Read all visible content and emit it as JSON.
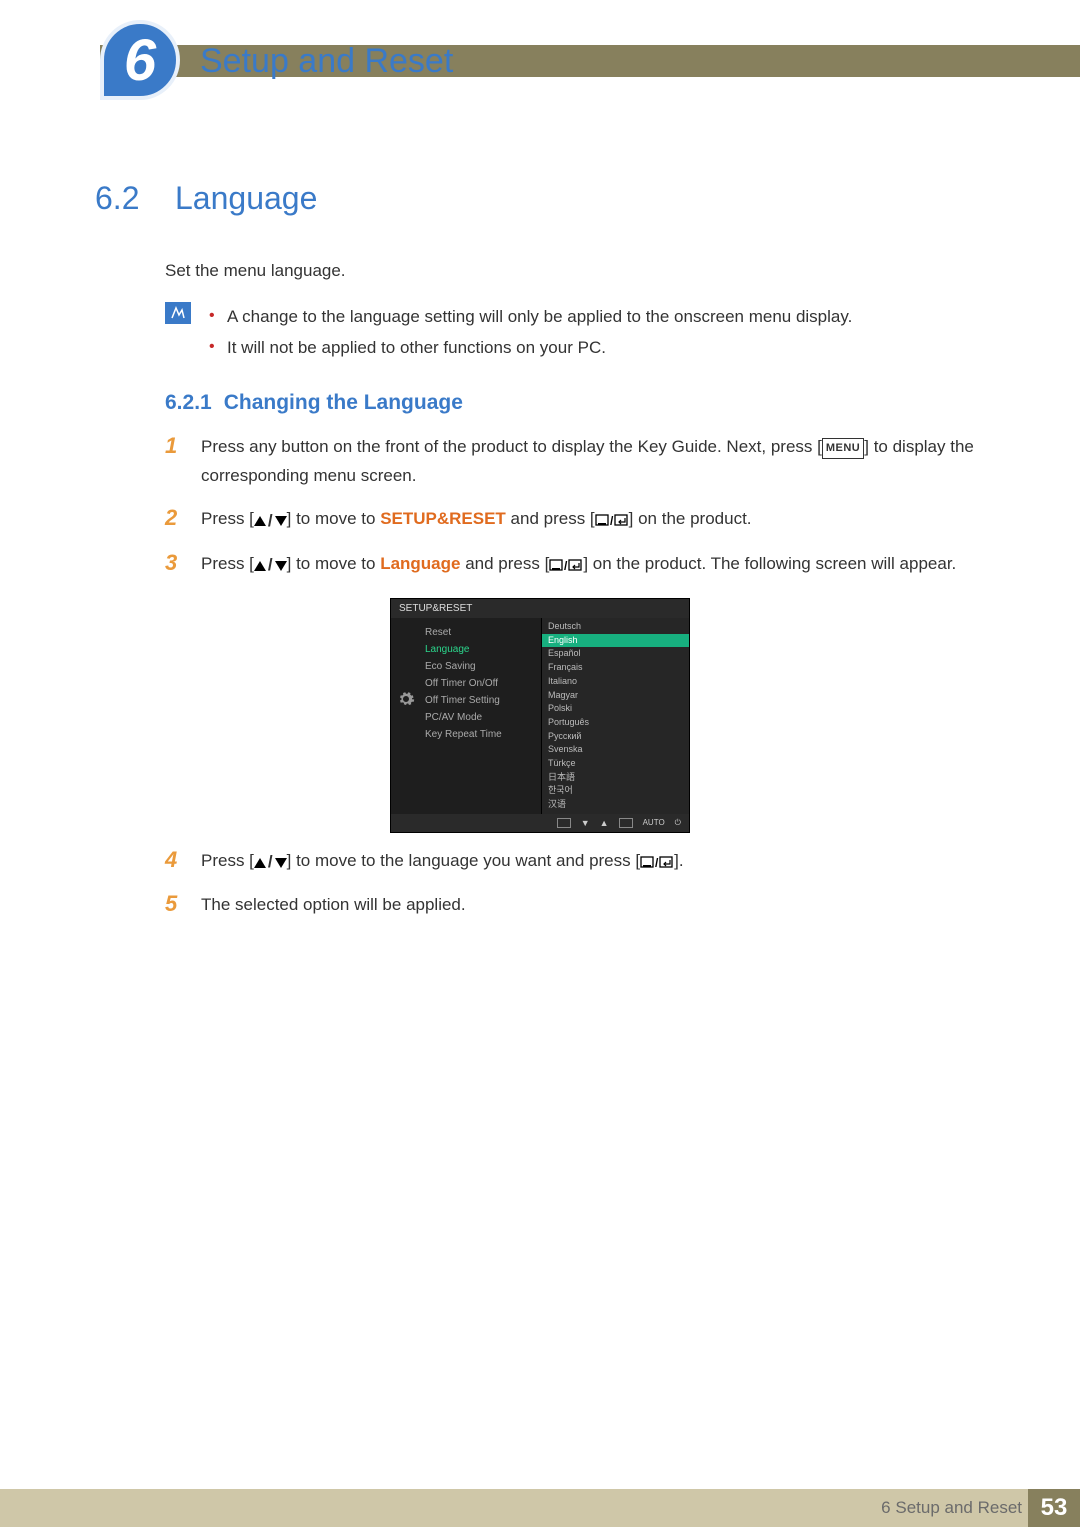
{
  "header": {
    "chapter_number": "6",
    "chapter_title": "Setup and Reset"
  },
  "section": {
    "number": "6.2",
    "title": "Language",
    "intro": "Set the menu language."
  },
  "notes": [
    "A change to the language setting will only be applied to the onscreen menu display.",
    "It will not be applied to other functions on your PC."
  ],
  "subsection": {
    "number": "6.2.1",
    "title": "Changing the Language"
  },
  "steps": {
    "s1a": "Press any button on the front of the product to display the Key Guide. Next, press [",
    "s1_menu": "MENU",
    "s1b": "] to display the corresponding menu screen.",
    "s2a": "Press [",
    "s2b": "] to move to ",
    "s2_kw": "SETUP&RESET",
    "s2c": " and press [",
    "s2d": "] on the product.",
    "s3a": "Press [",
    "s3b": "] to move to ",
    "s3_kw": "Language",
    "s3c": " and press [",
    "s3d": "] on the product. The following screen will appear.",
    "s4a": "Press [",
    "s4b": "] to move to the language you want and press [",
    "s4c": "].",
    "s5": "The selected option will be applied."
  },
  "osd": {
    "title": "SETUP&RESET",
    "left": [
      "Reset",
      "Language",
      "Eco Saving",
      "Off Timer On/Off",
      "Off Timer Setting",
      "PC/AV Mode",
      "Key Repeat Time"
    ],
    "left_highlight_index": 1,
    "right": [
      "Deutsch",
      "English",
      "Español",
      "Français",
      "Italiano",
      "Magyar",
      "Polski",
      "Português",
      "Русский",
      "Svenska",
      "Türkçe",
      "日本語",
      "한국어",
      "汉语"
    ],
    "right_selected_index": 1,
    "footer_auto": "AUTO"
  },
  "footer": {
    "text": "6 Setup and Reset",
    "page": "53"
  }
}
